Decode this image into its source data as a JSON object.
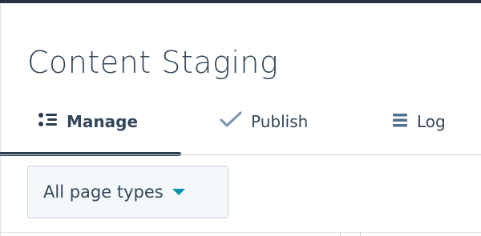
{
  "page": {
    "title": "Content Staging"
  },
  "tabs": [
    {
      "label": "Manage",
      "icon": "list-icon",
      "active": true
    },
    {
      "label": "Publish",
      "icon": "check-icon",
      "active": false
    },
    {
      "label": "Log",
      "icon": "menu-icon",
      "active": false
    }
  ],
  "filter": {
    "selected": "All page types"
  },
  "colors": {
    "top_bar": "#253342",
    "text": "#33475b",
    "active_tab_indicator": "#2d3e50",
    "check_icon": "#7c98b6",
    "menu_icon": "#516f90",
    "dropdown_bg": "#f5f8fa",
    "caret": "#0091ae"
  }
}
